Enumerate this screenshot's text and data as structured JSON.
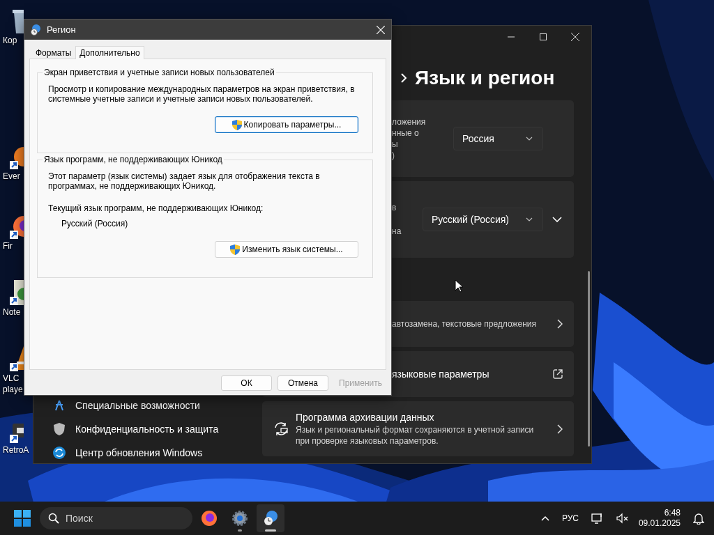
{
  "desktop_icons": [
    {
      "kind": "bin",
      "lines": [
        "Кор"
      ],
      "shortcut": false
    },
    {
      "kind": "app",
      "lines": [
        "Ever"
      ],
      "shortcut": true
    },
    {
      "kind": "firefox",
      "lines": [
        "Fir"
      ],
      "shortcut": true
    },
    {
      "kind": "notepad",
      "lines": [
        "Note"
      ],
      "shortcut": true
    },
    {
      "kind": "vlc",
      "lines": [
        "VLC",
        "playe"
      ],
      "shortcut": true
    },
    {
      "kind": "retro",
      "lines": [
        "RetroA"
      ],
      "shortcut": true
    }
  ],
  "settings_window": {
    "heading": "Язык и регион",
    "cards": [
      {
        "kind": "dropdown",
        "lines": [
          "ложения",
          "нные о",
          "ы",
          ")"
        ],
        "value": "Россия"
      },
      {
        "kind": "dropdown",
        "lines": [
          "в",
          "на"
        ],
        "value": "Русский (Россия)",
        "expanded": false
      },
      {
        "kind": "chevron",
        "description": "автозамена, текстовые предложения"
      },
      {
        "kind": "link",
        "title": "языковые параметры"
      },
      {
        "kind": "icon",
        "title": "Программа архивации данных",
        "description": "Язык и региональный формат сохраняются в учетной записи при проверке языковых параметров."
      }
    ],
    "nav": [
      {
        "kind": "accessibility",
        "label": "Специальные возможности"
      },
      {
        "kind": "shield",
        "label": "Конфиденциальность и защита"
      },
      {
        "kind": "update",
        "label": "Центр обновления Windows"
      }
    ]
  },
  "region_dialog": {
    "title": "Регион",
    "tabs": [
      {
        "label": "Форматы",
        "selected": false
      },
      {
        "label": "Дополнительно",
        "selected": true
      }
    ],
    "groups": [
      {
        "legend": "Экран приветствия и учетные записи новых пользователей",
        "paragraphs": [
          "Просмотр и копирование международных параметров на экран приветствия, в системные учетные записи и учетные записи новых пользователей."
        ],
        "button": {
          "label": "Копировать параметры...",
          "focused": true
        }
      },
      {
        "legend": "Язык программ, не поддерживающих Юникод",
        "paragraphs": [
          "Этот параметр (язык системы) задает язык для отображения текста в программах, не поддерживающих Юникод.",
          "Текущий язык программ, не поддерживающих Юникод:"
        ],
        "value": "Русский (Россия)",
        "button": {
          "label": "Изменить язык системы...",
          "focused": false
        }
      }
    ],
    "buttons": [
      {
        "label": "ОК",
        "disabled": false
      },
      {
        "label": "Отмена",
        "disabled": false
      },
      {
        "label": "Применить",
        "disabled": true
      }
    ]
  },
  "taskbar": {
    "search": {
      "placeholder": "Поиск"
    },
    "apps": [
      {
        "kind": "firefox",
        "running": false,
        "active": false
      },
      {
        "kind": "settings",
        "running": true,
        "active": false
      },
      {
        "kind": "region",
        "running": true,
        "active": true
      }
    ],
    "language": "РУС",
    "time": "6:48",
    "date": "09.01.2025"
  }
}
